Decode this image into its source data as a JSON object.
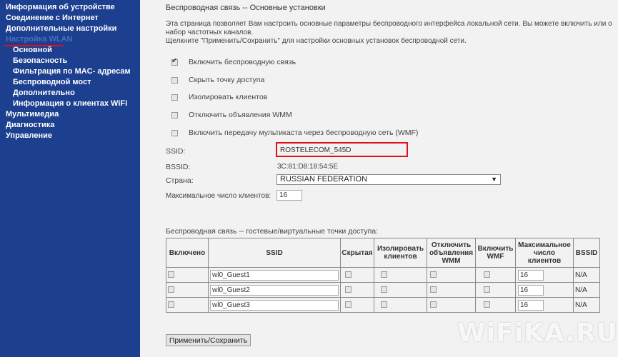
{
  "sidebar": {
    "items": [
      {
        "label": "Информация об устройстве"
      },
      {
        "label": "Соединение с Интернет"
      },
      {
        "label": "Дополнительные настройки"
      },
      {
        "label": "Настройка WLAN"
      },
      {
        "label": "Основной"
      },
      {
        "label": "Безопасность"
      },
      {
        "label": "Фильтрация по MAC- адресам"
      },
      {
        "label": "Беспроводной мост"
      },
      {
        "label": "Дополнительно"
      },
      {
        "label": "Информация о клиентах WiFi"
      },
      {
        "label": "Мультимедиа"
      },
      {
        "label": "Диагностика"
      },
      {
        "label": "Управление"
      }
    ]
  },
  "main": {
    "title": "Беспроводная связь -- Основные установки",
    "desc1": "Эта страница позволяет Вам настроить основные параметры беспроводного интерфейса локальной сети. Вы можете включить или о",
    "desc2": "набор частотных каналов.",
    "desc3": "Щелкните \"Применить/Сохранить\" для настройки основных установок беспроводной сети.",
    "options": [
      {
        "label": "Включить беспроводную связь",
        "checked": true
      },
      {
        "label": "Скрыть точку доступа",
        "checked": false
      },
      {
        "label": "Изолировать клиентов",
        "checked": false
      },
      {
        "label": "Отключить объявления WMM",
        "checked": false
      },
      {
        "label": "Включить передачу мультикаста через беспроводную сеть (WMF)",
        "checked": false
      }
    ],
    "ssid_label": "SSID:",
    "ssid_value": "ROSTELECOM_545D",
    "bssid_label": "BSSID:",
    "bssid_value": "3C:81:D8:18:54:5E",
    "country_label": "Страна:",
    "country_value": "RUSSIAN FEDERATION",
    "max_clients_label": "Максимальное число клиентов:",
    "max_clients_value": "16",
    "guest_title": "Беспроводная связь -- гостевые/виртуальные точки доступа:",
    "guest_headers": {
      "enabled": "Включено",
      "ssid": "SSID",
      "hidden": "Скрытая",
      "isolate_1": "Изолировать",
      "isolate_2": "клиентов",
      "wmm_1": "Отключить",
      "wmm_2": "объявления",
      "wmm_3": "WMM",
      "wmf_1": "Включить",
      "wmf_2": "WMF",
      "max_1": "Максимальное",
      "max_2": "число",
      "max_3": "клиентов",
      "bssid": "BSSID"
    },
    "guest_rows": [
      {
        "ssid": "wl0_Guest1",
        "max": "16",
        "bssid": "N/A"
      },
      {
        "ssid": "wl0_Guest2",
        "max": "16",
        "bssid": "N/A"
      },
      {
        "ssid": "wl0_Guest3",
        "max": "16",
        "bssid": "N/A"
      }
    ],
    "apply_label": "Применить/Сохранить"
  },
  "watermark": "WiFiKA.RU"
}
